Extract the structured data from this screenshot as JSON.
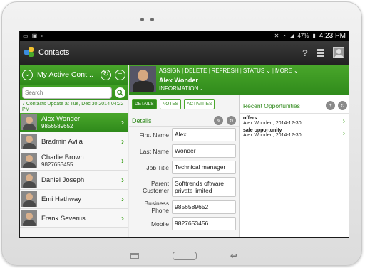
{
  "status_bar": {
    "battery": "47%",
    "time": "4:23 PM",
    "left_icons": [
      "notification-icon",
      "image-icon",
      "screenshot-icon"
    ],
    "right_icons": [
      "mute-icon",
      "wifi-icon",
      "signal-icon",
      "battery-icon"
    ]
  },
  "app": {
    "title": "Contacts"
  },
  "contacts_panel": {
    "title": "My Active Cont...",
    "search_placeholder": "Search",
    "update_text": "7 Contacts Update at Tue, Dec 30 2014 04:22 PM",
    "contacts": [
      {
        "name": "Alex Wonder",
        "phone": "9856589652",
        "selected": true
      },
      {
        "name": "Bradmin Avila",
        "phone": ""
      },
      {
        "name": "Charlie Brown",
        "phone": "9827653455"
      },
      {
        "name": "Daniel Joseph",
        "phone": ""
      },
      {
        "name": "Emi Hathway",
        "phone": ""
      },
      {
        "name": "Frank Severus",
        "phone": ""
      }
    ]
  },
  "detail": {
    "actions": [
      "ASSIGN",
      "DELETE",
      "REFRESH",
      "STATUS",
      "MORE"
    ],
    "name": "Alex Wonder",
    "info_label": "INFORMATION",
    "tabs": [
      "DETAILS",
      "NOTES",
      "ACTIVITIES"
    ],
    "section_title": "Details",
    "fields": [
      {
        "label": "First Name",
        "value": "Alex"
      },
      {
        "label": "Last Name",
        "value": "Wonder"
      },
      {
        "label": "Job Title",
        "value": "Technical manager"
      },
      {
        "label": "Parent Customer",
        "value": "Softtrends oftware private limited"
      },
      {
        "label": "Business Phone",
        "value": "9856589652"
      },
      {
        "label": "Mobile",
        "value": "9827653456"
      }
    ]
  },
  "opportunities": {
    "title": "Recent Opportunities",
    "items": [
      {
        "name": "offers",
        "meta": "Alex Wonder , 2014-12-30"
      },
      {
        "name": "sale opportunity",
        "meta": "Alex Wonder , 2014-12-30"
      }
    ]
  },
  "colors": {
    "accent": "#2f8a1b",
    "accent_light": "#4aa72b",
    "action_bar": "#222222"
  }
}
